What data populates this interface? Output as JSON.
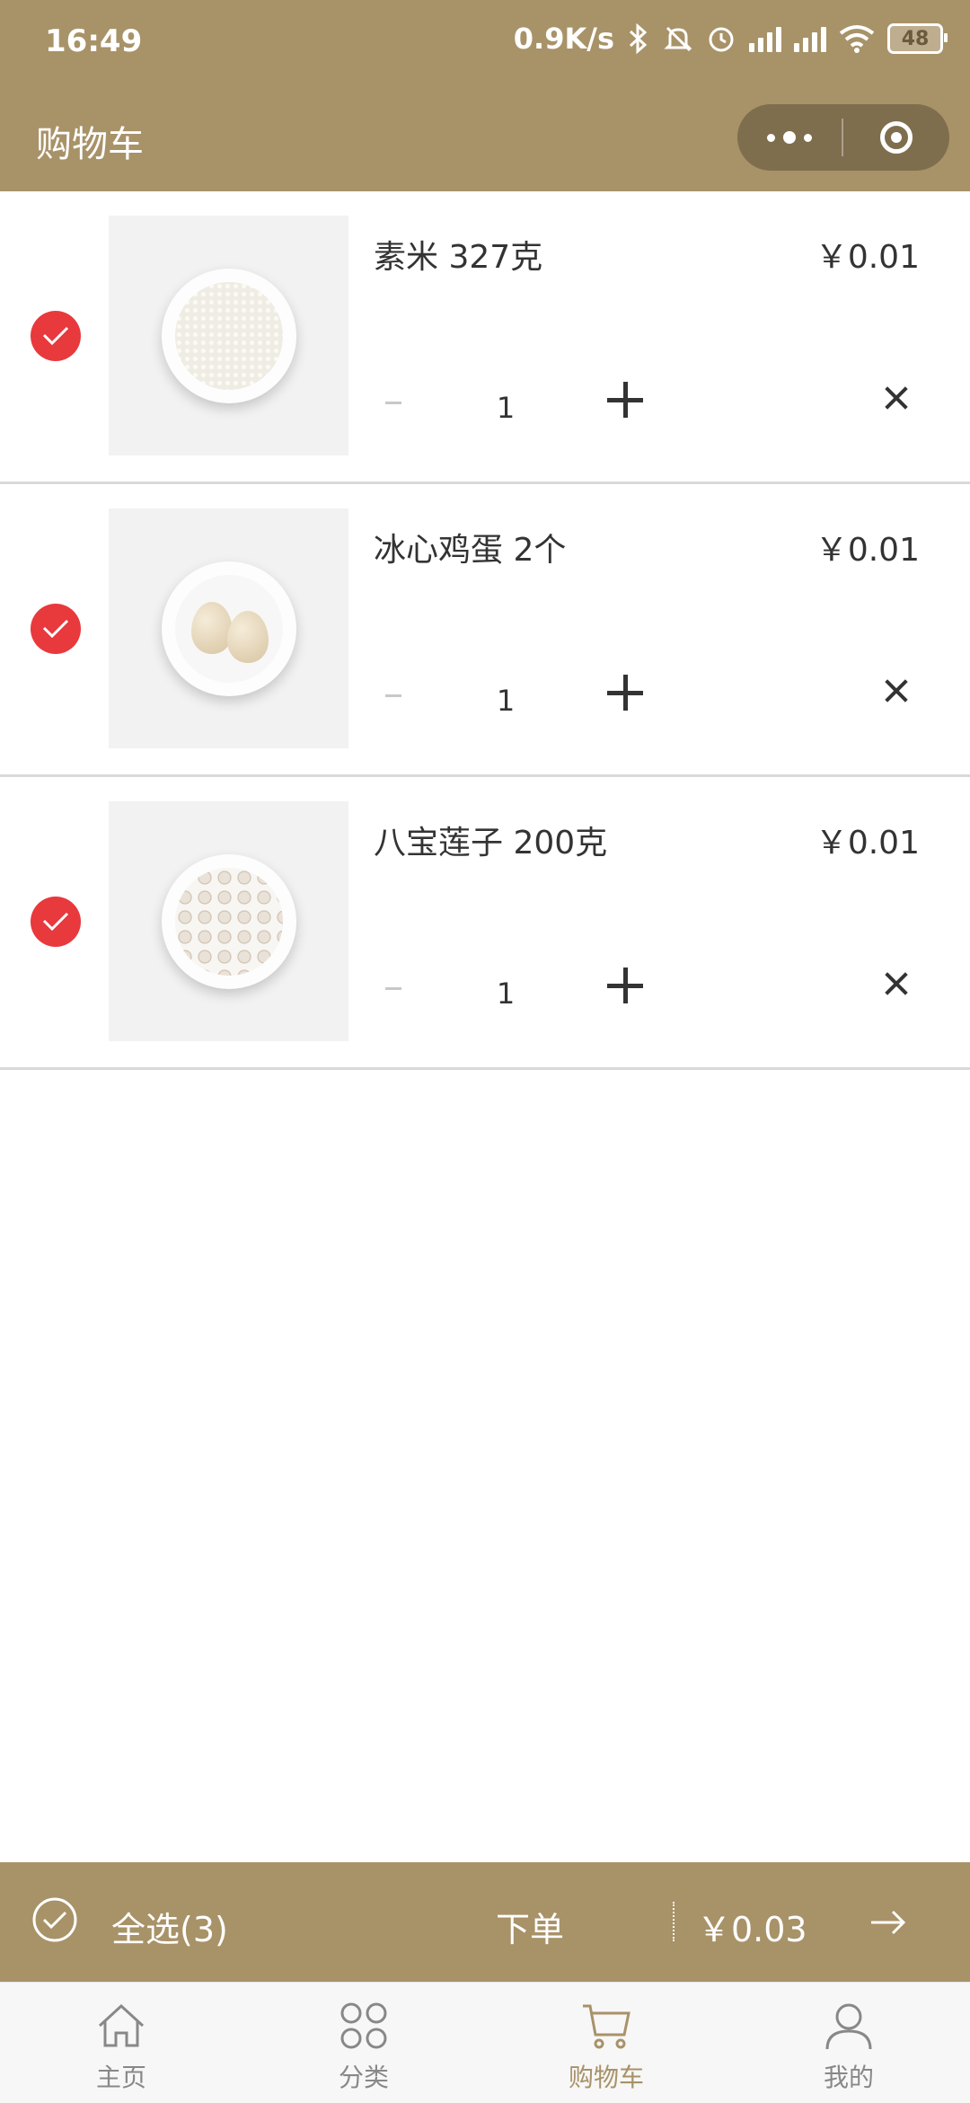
{
  "status_bar": {
    "time": "16:49",
    "network_speed": "0.9K/s",
    "battery": "48"
  },
  "header": {
    "title": "购物车"
  },
  "cart": {
    "items": [
      {
        "name": "素米 327克",
        "price": "￥0.01",
        "quantity": "1",
        "checked": true,
        "image": "rice-plate"
      },
      {
        "name": "冰心鸡蛋 2个",
        "price": "￥0.01",
        "quantity": "1",
        "checked": true,
        "image": "eggs-plate"
      },
      {
        "name": "八宝莲子 200克",
        "price": "￥0.01",
        "quantity": "1",
        "checked": true,
        "image": "lotus-seeds-plate"
      }
    ]
  },
  "checkout": {
    "select_all_label": "全选(3)",
    "order_label": "下单",
    "total": "￥0.03"
  },
  "tabbar": {
    "tabs": [
      {
        "label": "主页",
        "icon": "home-icon",
        "active": false
      },
      {
        "label": "分类",
        "icon": "category-icon",
        "active": false
      },
      {
        "label": "购物车",
        "icon": "cart-icon",
        "active": true
      },
      {
        "label": "我的",
        "icon": "user-icon",
        "active": false
      }
    ]
  },
  "colors": {
    "brand": "#a89268",
    "check": "#e8393d",
    "active_tab": "#a89268"
  }
}
